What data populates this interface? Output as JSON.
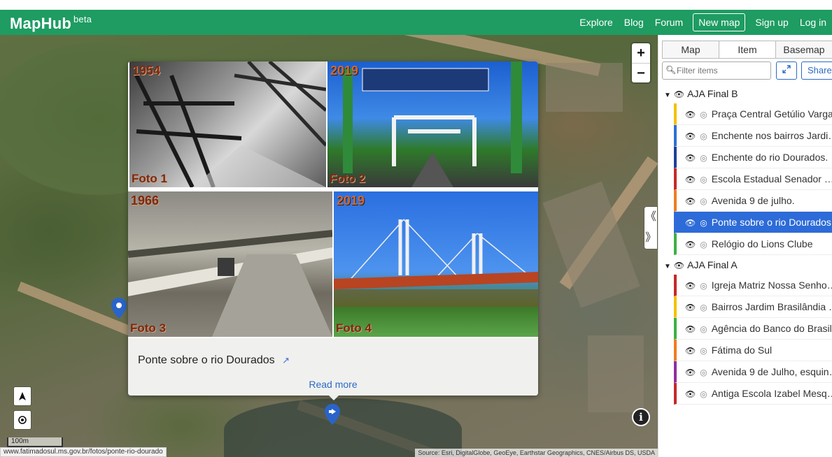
{
  "header": {
    "brand": "MapHub",
    "brand_sup": "beta",
    "nav": {
      "explore": "Explore",
      "blog": "Blog",
      "forum": "Forum",
      "new_map": "New map",
      "sign_up": "Sign up",
      "log_in": "Log in"
    }
  },
  "map": {
    "zoom_in": "+",
    "zoom_out": "−",
    "scale_label": "100m",
    "attribution": "Source: Esri, DigitalGlobe, GeoEye, Earthstar Geographics, CNES/Airbus DS, USDA",
    "status_url": "www.fatimadosul.ms.gov.br/fotos/ponte-rio-dourado",
    "info": "i",
    "collapse_left": "《",
    "collapse_right": "》"
  },
  "popup": {
    "photos": [
      {
        "year": "1954",
        "caption": "Foto 1"
      },
      {
        "year": "2019",
        "caption": "Foto 2"
      },
      {
        "year": "1966",
        "caption": "Foto 3"
      },
      {
        "year": "2019",
        "caption": "Foto 4"
      }
    ],
    "title": "Ponte sobre o rio Dourados",
    "read_more": "Read more"
  },
  "sidebar": {
    "tabs": [
      "Map",
      "Item",
      "Basemap"
    ],
    "active_tab": "Item",
    "filter_placeholder": "Filter items",
    "share_label": "Share",
    "groups": [
      {
        "name": "AJA Final B",
        "items": [
          {
            "label": "Praça Central Getúlio Vargas",
            "color": "#f2c200",
            "active": false
          },
          {
            "label": "Enchente nos bairros Jardi…",
            "color": "#2f6fd6",
            "active": false
          },
          {
            "label": "Enchente do rio Dourados.",
            "color": "#1e3f9a",
            "active": false
          },
          {
            "label": "Escola Estadual Senador …",
            "color": "#c62828",
            "active": false
          },
          {
            "label": "Avenida 9 de julho.",
            "color": "#ef7d22",
            "active": false
          },
          {
            "label": "Ponte sobre o rio Dourados",
            "color": "#2d6bd8",
            "active": true
          },
          {
            "label": "Relógio do Lions Clube",
            "color": "#3cb043",
            "active": false
          }
        ]
      },
      {
        "name": "AJA Final A",
        "items": [
          {
            "label": "Igreja Matriz Nossa Senho…",
            "color": "#c62828",
            "active": false
          },
          {
            "label": "Bairros Jardim Brasilândia …",
            "color": "#f2c200",
            "active": false
          },
          {
            "label": "Agência do Banco do Brasil …",
            "color": "#3cb043",
            "active": false
          },
          {
            "label": "Fátima do Sul",
            "color": "#ef7d22",
            "active": false
          },
          {
            "label": "Avenida 9 de Julho, esquin…",
            "color": "#8e2fa0",
            "active": false
          },
          {
            "label": "Antiga Escola Izabel Mesq…",
            "color": "#c62828",
            "active": false
          }
        ]
      }
    ]
  }
}
